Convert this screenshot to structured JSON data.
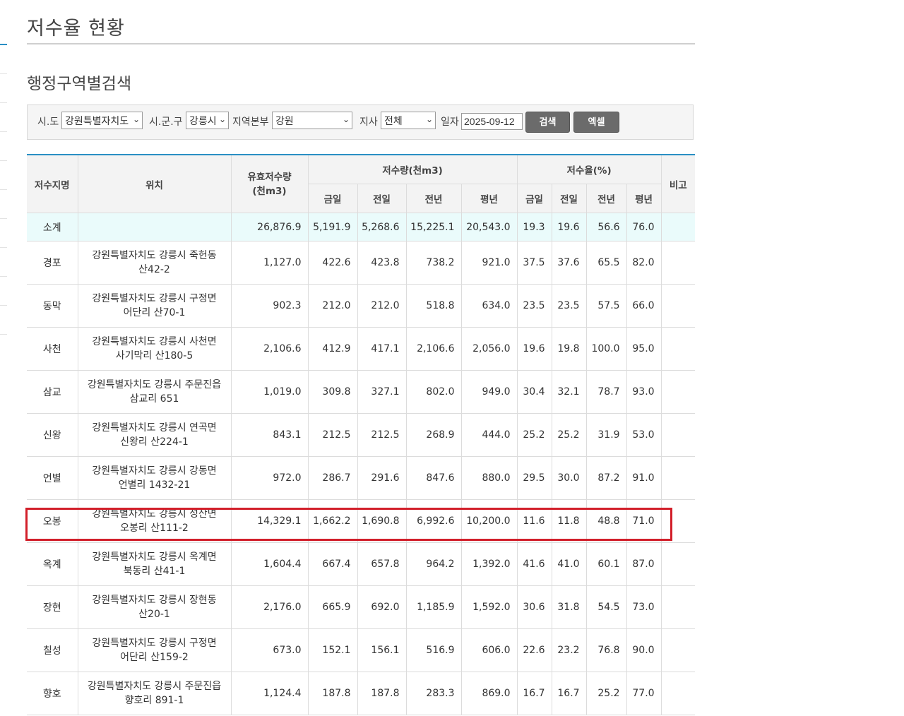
{
  "page": {
    "title": "저수율 현황",
    "section_title": "행정구역별검색"
  },
  "search": {
    "sido_label": "시.도",
    "sido_value": "강원특별자치도",
    "sigungu_label": "시.군.구",
    "sigungu_value": "강릉시",
    "region_label": "지역본부",
    "region_value": "강원",
    "branch_label": "지사",
    "branch_value": "전체",
    "date_label": "일자",
    "date_value": "2025-09-12",
    "search_button": "검색",
    "excel_button": "엑셀"
  },
  "table": {
    "headers": {
      "name": "저수지명",
      "location": "위치",
      "effective_line1": "유효저수량",
      "effective_line2": "(천m3)",
      "volume_group": "저수량(천m3)",
      "rate_group": "저수율(%)",
      "note": "비고",
      "today": "금일",
      "yesterday": "전일",
      "last_year": "전년",
      "average": "평년"
    },
    "subtotal": {
      "name": "소계",
      "effective": "26,876.9",
      "v_today": "5,191.9",
      "v_yesterday": "5,268.6",
      "v_last_year": "15,225.1",
      "v_average": "20,543.0",
      "r_today": "19.3",
      "r_yesterday": "19.6",
      "r_last_year": "56.6",
      "r_average": "76.0"
    },
    "rows": [
      {
        "name": "경포",
        "loc1": "강원특별자치도 강릉시 죽헌동",
        "loc2": "산42-2",
        "effective": "1,127.0",
        "v_today": "422.6",
        "v_yesterday": "423.8",
        "v_last_year": "738.2",
        "v_average": "921.0",
        "r_today": "37.5",
        "r_yesterday": "37.6",
        "r_last_year": "65.5",
        "r_average": "82.0"
      },
      {
        "name": "동막",
        "loc1": "강원특별자치도 강릉시 구정면",
        "loc2": "어단리 산70-1",
        "effective": "902.3",
        "v_today": "212.0",
        "v_yesterday": "212.0",
        "v_last_year": "518.8",
        "v_average": "634.0",
        "r_today": "23.5",
        "r_yesterday": "23.5",
        "r_last_year": "57.5",
        "r_average": "66.0"
      },
      {
        "name": "사천",
        "loc1": "강원특별자치도 강릉시 사천면",
        "loc2": "사기막리 산180-5",
        "effective": "2,106.6",
        "v_today": "412.9",
        "v_yesterday": "417.1",
        "v_last_year": "2,106.6",
        "v_average": "2,056.0",
        "r_today": "19.6",
        "r_yesterday": "19.8",
        "r_last_year": "100.0",
        "r_average": "95.0"
      },
      {
        "name": "삼교",
        "loc1": "강원특별자치도 강릉시 주문진읍",
        "loc2": "삼교리 651",
        "effective": "1,019.0",
        "v_today": "309.8",
        "v_yesterday": "327.1",
        "v_last_year": "802.0",
        "v_average": "949.0",
        "r_today": "30.4",
        "r_yesterday": "32.1",
        "r_last_year": "78.7",
        "r_average": "93.0"
      },
      {
        "name": "신왕",
        "loc1": "강원특별자치도 강릉시 연곡면",
        "loc2": "신왕리 산224-1",
        "effective": "843.1",
        "v_today": "212.5",
        "v_yesterday": "212.5",
        "v_last_year": "268.9",
        "v_average": "444.0",
        "r_today": "25.2",
        "r_yesterday": "25.2",
        "r_last_year": "31.9",
        "r_average": "53.0"
      },
      {
        "name": "언별",
        "loc1": "강원특별자치도 강릉시 강동면",
        "loc2": "언별리 1432-21",
        "effective": "972.0",
        "v_today": "286.7",
        "v_yesterday": "291.6",
        "v_last_year": "847.6",
        "v_average": "880.0",
        "r_today": "29.5",
        "r_yesterday": "30.0",
        "r_last_year": "87.2",
        "r_average": "91.0"
      },
      {
        "name": "오봉",
        "loc1": "강원특별자치도 강릉시 성산면",
        "loc2": "오봉리 산111-2",
        "effective": "14,329.1",
        "v_today": "1,662.2",
        "v_yesterday": "1,690.8",
        "v_last_year": "6,992.6",
        "v_average": "10,200.0",
        "r_today": "11.6",
        "r_yesterday": "11.8",
        "r_last_year": "48.8",
        "r_average": "71.0"
      },
      {
        "name": "옥계",
        "loc1": "강원특별자치도 강릉시 옥계면",
        "loc2": "북동리 산41-1",
        "effective": "1,604.4",
        "v_today": "667.4",
        "v_yesterday": "657.8",
        "v_last_year": "964.2",
        "v_average": "1,392.0",
        "r_today": "41.6",
        "r_yesterday": "41.0",
        "r_last_year": "60.1",
        "r_average": "87.0"
      },
      {
        "name": "장현",
        "loc1": "강원특별자치도 강릉시 장현동",
        "loc2": "산20-1",
        "effective": "2,176.0",
        "v_today": "665.9",
        "v_yesterday": "692.0",
        "v_last_year": "1,185.9",
        "v_average": "1,592.0",
        "r_today": "30.6",
        "r_yesterday": "31.8",
        "r_last_year": "54.5",
        "r_average": "73.0"
      },
      {
        "name": "칠성",
        "loc1": "강원특별자치도 강릉시 구정면",
        "loc2": "어단리 산159-2",
        "effective": "673.0",
        "v_today": "152.1",
        "v_yesterday": "156.1",
        "v_last_year": "516.9",
        "v_average": "606.0",
        "r_today": "22.6",
        "r_yesterday": "23.2",
        "r_last_year": "76.8",
        "r_average": "90.0"
      },
      {
        "name": "향호",
        "loc1": "강원특별자치도 강릉시 주문진읍",
        "loc2": "향호리 891-1",
        "effective": "1,124.4",
        "v_today": "187.8",
        "v_yesterday": "187.8",
        "v_last_year": "283.3",
        "v_average": "869.0",
        "r_today": "16.7",
        "r_yesterday": "16.7",
        "r_last_year": "25.2",
        "r_average": "77.0"
      }
    ]
  },
  "highlight_row": "오봉"
}
